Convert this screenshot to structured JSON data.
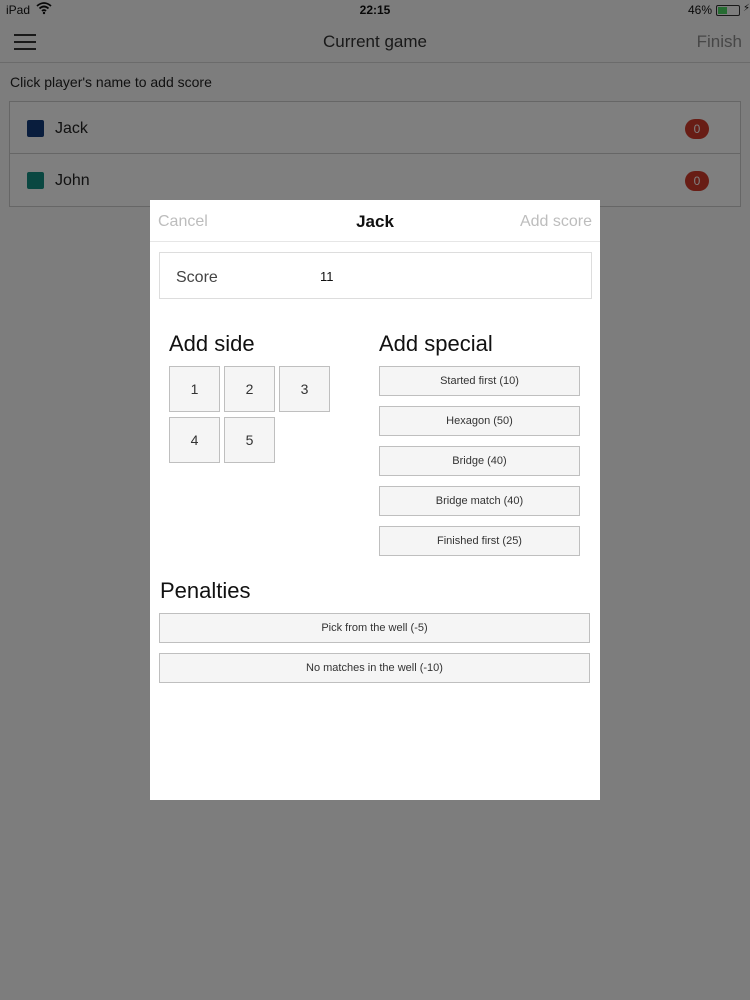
{
  "status_bar": {
    "carrier": "iPad",
    "wifi_icon": "wifi-icon",
    "time": "22:15",
    "battery_percent": "46%",
    "battery_level": 0.46,
    "battery_color": "#4cd964"
  },
  "navbar": {
    "menu_icon": "hamburger-menu-icon",
    "title": "Current game",
    "finish_label": "Finish"
  },
  "instruction": "Click player's name to add score",
  "players": [
    {
      "name": "Jack",
      "color": "#123a7a",
      "score": "0"
    },
    {
      "name": "John",
      "color": "#148f82",
      "score": "0"
    }
  ],
  "score_badge_color": "#d03a2a",
  "modal": {
    "cancel_label": "Cancel",
    "title": "Jack",
    "add_score_label": "Add score",
    "score_label": "Score",
    "score_value": "11",
    "add_side_title": "Add side",
    "sides": [
      "1",
      "2",
      "3",
      "4",
      "5"
    ],
    "add_special_title": "Add special",
    "specials": [
      "Started first (10)",
      "Hexagon (50)",
      "Bridge (40)",
      "Bridge match (40)",
      "Finished first (25)"
    ],
    "penalties_title": "Penalties",
    "penalties": [
      "Pick from the well (-5)",
      "No matches in the well (-10)"
    ]
  }
}
